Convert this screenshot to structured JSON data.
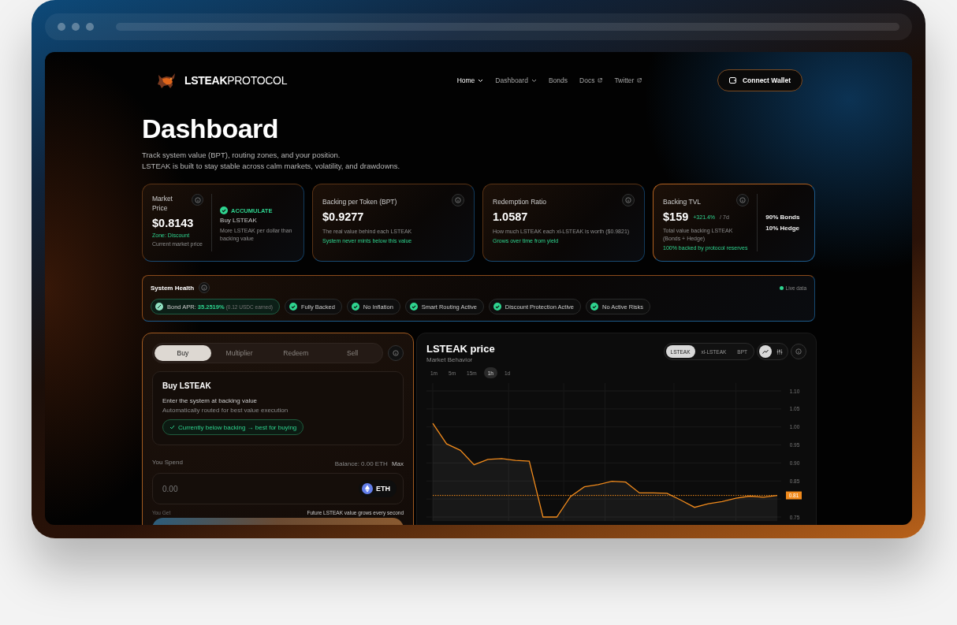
{
  "browser": {
    "kind": "mockup"
  },
  "nav": {
    "logo": "LSTEAK",
    "logo_suffix": "PROTOCOL",
    "links": [
      {
        "label": "Home",
        "selected": true,
        "kind": "dropdown"
      },
      {
        "label": "Dashboard",
        "selected": false,
        "kind": "dropdown"
      },
      {
        "label": "Bonds",
        "selected": false,
        "kind": "plain"
      },
      {
        "label": "Docs",
        "selected": false,
        "kind": "external"
      },
      {
        "label": "Twitter",
        "selected": false,
        "kind": "external"
      }
    ],
    "connect_button": "Connect Wallet"
  },
  "page": {
    "title": "Dashboard",
    "subtitle_lines": [
      "Track system value (BPT), routing zones, and your position.",
      "LSTEAK is built to stay stable across calm markets, volatility, and drawdowns."
    ]
  },
  "stats": [
    {
      "kind": "market",
      "label": "Market Price",
      "value": "$0.8143",
      "zone": "Zone: Discount",
      "caption": "Current market price",
      "signal": {
        "label": "ACCUMULATE",
        "title": "Buy LSTEAK",
        "text": "More LSTEAK per dollar than backing value"
      }
    },
    {
      "kind": "basic",
      "label": "Backing per Token (BPT)",
      "value": "$0.9277",
      "description": "The real value behind each LSTEAK",
      "note": "System never mints below this value"
    },
    {
      "kind": "basic",
      "label": "Redemption Ratio",
      "value": "1.0587",
      "description": "How much LSTEAK each xl-LSTEAK is worth ($0.9821)",
      "note": "Grows over time from yield"
    },
    {
      "kind": "tvl",
      "label": "Backing TVL",
      "value": "$159",
      "change": "+321.4%",
      "period": "/ 7d",
      "description": "Total value backing LSTEAK (Bonds + Hedge)",
      "note": "100% backed by protocol reserves",
      "split": [
        "90% Bonds",
        "10% Hedge"
      ]
    }
  ],
  "health": {
    "title": "System Health",
    "live": "Live data",
    "chips": [
      {
        "kind": "apr",
        "label": "Bond APR:",
        "value": "35.2519%",
        "detail": "(0.12 USDC earned)"
      },
      {
        "kind": "check",
        "label": "Fully Backed"
      },
      {
        "kind": "check",
        "label": "No Inflation"
      },
      {
        "kind": "check",
        "label": "Smart Routing Active"
      },
      {
        "kind": "check",
        "label": "Discount Protection Active"
      },
      {
        "kind": "check",
        "label": "No Active Risks"
      }
    ]
  },
  "trade": {
    "tabs": [
      {
        "label": "Buy",
        "selected": true
      },
      {
        "label": "Multiplier",
        "selected": false
      },
      {
        "label": "Redeem",
        "selected": false
      },
      {
        "label": "Sell",
        "selected": false
      }
    ],
    "card": {
      "title": "Buy LSTEAK",
      "line1": "Enter the system at backing value",
      "line2": "Automatically routed for best value execution",
      "badge": "Currently below backing → best for buying"
    },
    "spend_label": "You Spend",
    "balance": "Balance: 0.00 ETH",
    "max": "Max",
    "placeholder": "0.00",
    "token": "ETH",
    "get_label": "You Get",
    "note": "Future LSTEAK value grows every second"
  },
  "price": {
    "title": "LSTEAK price",
    "subtitle": "Market Behavior",
    "series_tabs": [
      {
        "label": "LSTEAK",
        "selected": true
      },
      {
        "label": "xl-LSTEAK",
        "selected": false
      },
      {
        "label": "BPT",
        "selected": false
      }
    ],
    "chart_types": [
      {
        "kind": "area",
        "selected": true
      },
      {
        "kind": "candles",
        "selected": false
      }
    ],
    "timeframes": [
      {
        "label": "1m",
        "selected": false
      },
      {
        "label": "5m",
        "selected": false
      },
      {
        "label": "15m",
        "selected": false
      },
      {
        "label": "1h",
        "selected": true
      },
      {
        "label": "1d",
        "selected": false
      }
    ],
    "chart_data": {
      "type": "area",
      "grid": true,
      "ylim": [
        0.75,
        1.1
      ],
      "yticks": [
        {
          "value": 0.75,
          "label": "0.75"
        },
        {
          "value": 0.85,
          "label": "0.85"
        },
        {
          "value": 0.9,
          "label": "0.90"
        },
        {
          "value": 0.95,
          "label": "0.95"
        },
        {
          "value": 1.0,
          "label": "1.00"
        },
        {
          "value": 1.05,
          "label": "1.05"
        },
        {
          "value": 1.1,
          "label": "1.10"
        }
      ],
      "series": [
        {
          "type": "area",
          "color": "#f08a1c",
          "values": [
            1.01,
            0.953,
            0.935,
            0.895,
            0.91,
            0.912,
            0.907,
            0.905,
            0.75,
            0.75,
            0.807,
            0.834,
            0.84,
            0.849,
            0.847,
            0.817,
            0.817,
            0.816,
            0.797,
            0.777,
            0.787,
            0.793,
            0.802,
            0.808,
            0.805,
            0.81
          ]
        },
        {
          "type": "line",
          "line_style": "dashed",
          "color": "#f08a1c",
          "values": [
            0.81,
            0.81,
            0.81,
            0.81,
            0.81,
            0.81,
            0.81,
            0.81,
            0.81,
            0.81,
            0.81,
            0.81,
            0.81,
            0.81,
            0.81,
            0.81,
            0.81,
            0.81,
            0.81,
            0.81,
            0.81,
            0.81,
            0.81,
            0.81,
            0.81,
            0.81
          ]
        }
      ]
    },
    "current_price": "0.81"
  }
}
